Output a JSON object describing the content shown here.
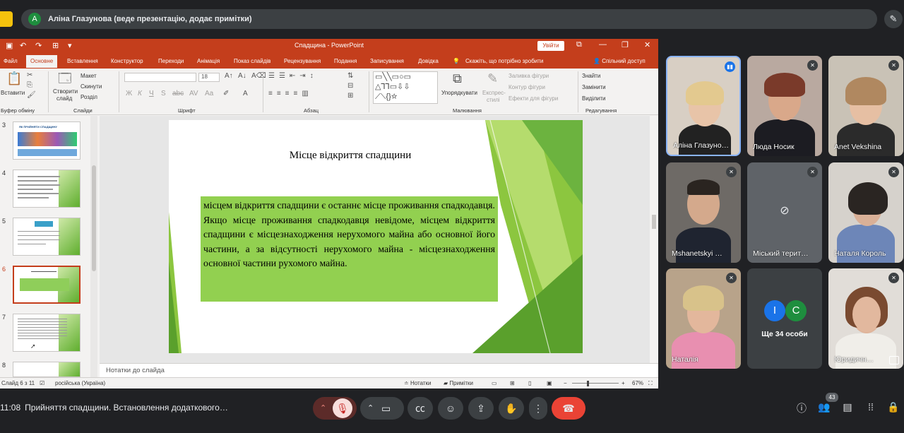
{
  "meet": {
    "presenter_initial": "A",
    "presenter_banner": "Аліна Глазунова (веде презентацію, додає примітки)",
    "time": "11:08",
    "meeting_title": "Прийняття спадщини. Встановлення додаткового…",
    "participants_count": "43",
    "more_people_label": "Ще 34 особи",
    "more_initials": [
      "I",
      "C"
    ]
  },
  "ppt": {
    "window_title": "Спадщина - PowerPoint",
    "signin_label": "Увійти",
    "share_label": "Спільний доступ",
    "tell_me": "Скажіть, що потрібно зробити",
    "tabs": [
      "Файл",
      "Основне",
      "Вставлення",
      "Конструктор",
      "Переходи",
      "Анімація",
      "Показ слайдів",
      "Рецензування",
      "Подання",
      "Записування",
      "Довідка"
    ],
    "ribbon": {
      "paste": "Вставити",
      "clipboard_group": "Буфер обміну",
      "new_slide_1": "Створити",
      "new_slide_2": "слайд",
      "layout": "Макет",
      "reset": "Скинути",
      "section": "Розділ",
      "slides_group": "Слайди",
      "font_group": "Шрифт",
      "paragraph_group": "Абзац",
      "arrange": "Упорядкувати",
      "express_1": "Експрес-",
      "express_2": "стилі",
      "fill": "Заливка фігури",
      "outline": "Контур фігури",
      "effects": "Ефекти для фігури",
      "drawing_group": "Малювання",
      "find": "Знайти",
      "replace": "Замінити",
      "select": "Виділити",
      "editing_group": "Редагування",
      "font_size": "18"
    },
    "thumbnail_numbers": [
      "3",
      "4",
      "5",
      "6",
      "7",
      "8"
    ],
    "thumb3_title": "ЯК ПРИЙНЯТИ СПАДЩИНУ",
    "slide": {
      "title": "Місце відкриття спадщини",
      "para1": "місцем відкриття спадщини є останнє місце проживання спадкодавця.",
      "para2": "Якщо місце проживання спадкодавця невідоме, місцем відкриття спадщини є місцезнаходження нерухомого майна або основної його частини, а за відсутності нерухомого майна - місцезнаходження основної частини рухомого майна."
    },
    "notes_placeholder": "Нотатки до слайда",
    "status": {
      "slide_counter": "Слайд 6 з 11",
      "language": "російська (Україна)",
      "notes": "Нотатки",
      "comments": "Примітки",
      "zoom": "67%"
    }
  },
  "participants": [
    {
      "name": "Аліна Глазуно…",
      "speaking": true
    },
    {
      "name": "Люда Носик"
    },
    {
      "name": "Anet Vekshina"
    },
    {
      "name": "Mshanetskyi …"
    },
    {
      "name": "Міський терит…"
    },
    {
      "name": "Наталя Король"
    },
    {
      "name": "Наталія"
    },
    {
      "name": "Юридичн…"
    }
  ],
  "colors": {
    "ppt_accent": "#c43e1c",
    "slide_box": "#92d050",
    "meet_bg": "#202124",
    "end_call": "#ea4335"
  }
}
